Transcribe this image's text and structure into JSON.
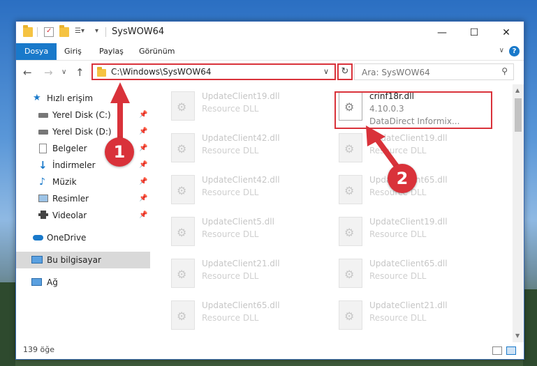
{
  "window": {
    "title": "SysWOW64",
    "minimize": "—",
    "maximize": "☐",
    "close": "✕"
  },
  "ribbon": {
    "tabs": [
      "Dosya",
      "Giriş",
      "Paylaş",
      "Görünüm"
    ],
    "help": "?"
  },
  "address": {
    "path": "C:\\Windows\\SysWOW64",
    "refresh": "↻",
    "dropdown": "∨"
  },
  "search": {
    "placeholder": "Ara: SysWOW64"
  },
  "sidebar": {
    "items": [
      {
        "label": "Hızlı erişim"
      },
      {
        "label": "Yerel Disk (C:)"
      },
      {
        "label": "Yerel Disk (D:)"
      },
      {
        "label": "Belgeler"
      },
      {
        "label": "İndirmeler"
      },
      {
        "label": "Müzik"
      },
      {
        "label": "Resimler"
      },
      {
        "label": "Videolar"
      },
      {
        "label": "OneDrive"
      },
      {
        "label": "Bu bilgisayar"
      },
      {
        "label": "Ağ"
      }
    ]
  },
  "files": {
    "left": [
      {
        "name": "UpdateClient19.dll",
        "type": "Resource DLL"
      },
      {
        "name": "UpdateClient42.dll",
        "type": "Resource DLL"
      },
      {
        "name": "UpdateClient42.dll",
        "type": "Resource DLL"
      },
      {
        "name": "UpdateClient5.dll",
        "type": "Resource DLL"
      },
      {
        "name": "UpdateClient21.dll",
        "type": "Resource DLL"
      },
      {
        "name": "UpdateClient65.dll",
        "type": "Resource DLL"
      }
    ],
    "right": [
      {
        "name": "UpdateClient19.dll",
        "type": "Resource DLL"
      },
      {
        "name": "UpdateClient65.dll",
        "type": "Resource DLL"
      },
      {
        "name": "UpdateClient19.dll",
        "type": "Resource DLL"
      },
      {
        "name": "UpdateClient65.dll",
        "type": "Resource DLL"
      },
      {
        "name": "UpdateClient21.dll",
        "type": "Resource DLL"
      }
    ],
    "highlighted": {
      "name": "crinf18r.dll",
      "version": "4.10.0.3",
      "company": "DataDirect Informix..."
    }
  },
  "status": {
    "count": "139 öğe"
  },
  "annotations": {
    "step1": "1",
    "step2": "2"
  },
  "colors": {
    "accent": "#1979ca",
    "highlight": "#d9323a"
  }
}
